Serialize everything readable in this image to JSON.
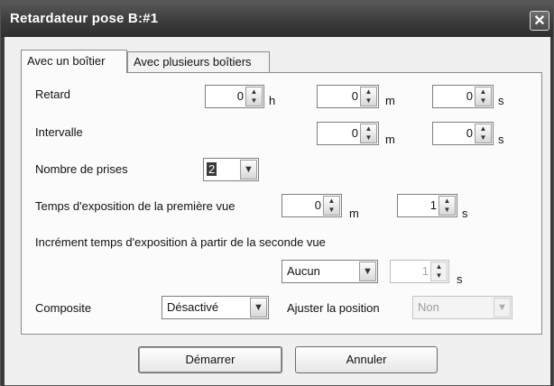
{
  "window": {
    "title": "Retardateur pose B:#1",
    "close": "✕"
  },
  "tabs": [
    {
      "label": "Avec un boîtier"
    },
    {
      "label": "Avec plusieurs boîtiers"
    }
  ],
  "delay": {
    "label": "Retard",
    "hours": "0",
    "hours_unit": "h",
    "minutes": "0",
    "minutes_unit": "m",
    "seconds": "0",
    "seconds_unit": "s"
  },
  "interval": {
    "label": "Intervalle",
    "minutes": "0",
    "minutes_unit": "m",
    "seconds": "0",
    "seconds_unit": "s"
  },
  "shots": {
    "label": "Nombre de prises",
    "value": "2"
  },
  "exposure_first": {
    "label": "Temps d'exposition de la première vue",
    "minutes": "0",
    "minutes_unit": "m",
    "seconds": "1",
    "seconds_unit": "s"
  },
  "increment": {
    "label": "Incrément temps d'exposition à partir de la seconde vue",
    "mode": "Aucun",
    "seconds": "1",
    "seconds_unit": "s"
  },
  "composite": {
    "label": "Composite",
    "value": "Désactivé"
  },
  "adjust_position": {
    "label": "Ajuster la position",
    "value": "Non"
  },
  "buttons": {
    "start": "Démarrer",
    "cancel": "Annuler"
  },
  "icons": {
    "spin_up": "▲",
    "spin_down": "▼",
    "dropdown": "▼"
  }
}
